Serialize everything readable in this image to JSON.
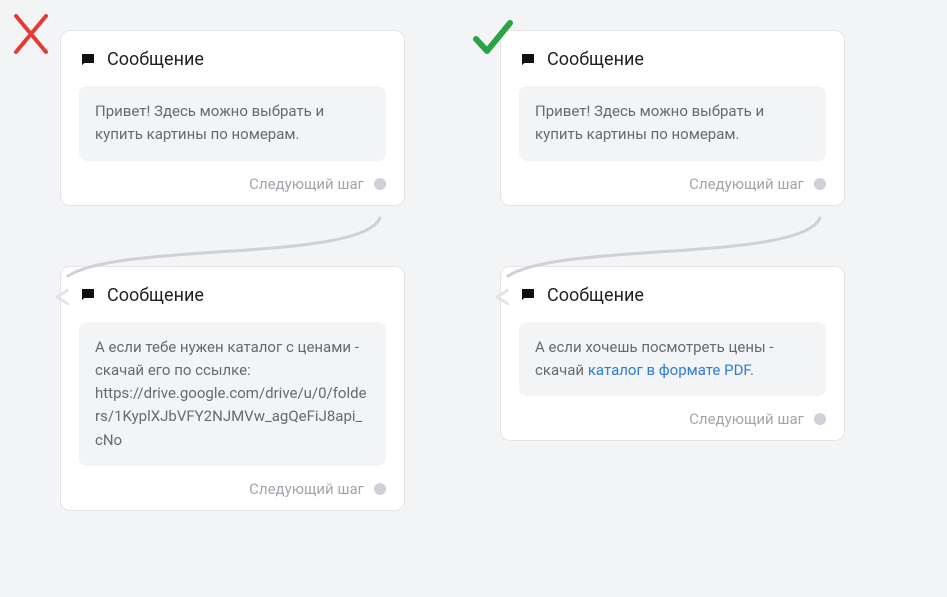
{
  "labels": {
    "message_title": "Сообщение",
    "next_step": "Следующий шаг"
  },
  "left": {
    "card1_text": "Привет! Здесь можно выбрать и купить картины по номерам.",
    "card2_text": "А если тебе нужен каталог с ценами - скачай его по ссылке: https://drive.google.com/drive/u/0/folders/1KyplXJbVFY2NJMVw_agQeFiJ8api_cNo"
  },
  "right": {
    "card1_text": "Привет! Здесь можно выбрать и купить картины по номерам.",
    "card2_prefix": "А если хочешь посмотреть цены - скачай ",
    "card2_link": "каталог в формате PDF."
  },
  "colors": {
    "x_mark": "#e53935",
    "check_mark": "#2aa346",
    "link": "#2e7cd6"
  }
}
